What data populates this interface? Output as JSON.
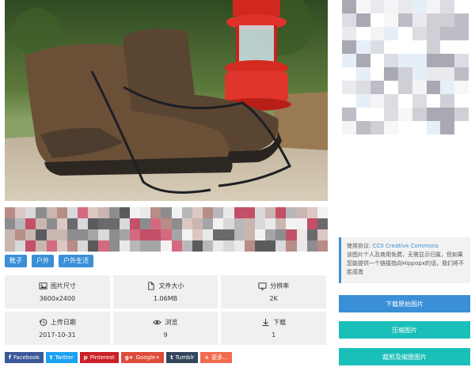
{
  "tags": [
    "靴子",
    "户外",
    "户外生活"
  ],
  "stats": [
    {
      "icon": "image-icon",
      "label": "图片尺寸",
      "value": "3600x2400"
    },
    {
      "icon": "file-icon",
      "label": "文件大小",
      "value": "1.06MB"
    },
    {
      "icon": "monitor-icon",
      "label": "分辨率",
      "value": "2K"
    },
    {
      "icon": "history-icon",
      "label": "上传日期",
      "value": "2017-10-31"
    },
    {
      "icon": "eye-icon",
      "label": "浏览",
      "value": "9"
    },
    {
      "icon": "download-icon",
      "label": "下载",
      "value": "1"
    }
  ],
  "share": [
    {
      "name": "facebook",
      "glyph": "f",
      "label": "Facebook",
      "color": "#3b5998"
    },
    {
      "name": "twitter",
      "glyph": "t",
      "label": "Twitter",
      "color": "#1da1f2"
    },
    {
      "name": "pinterest",
      "glyph": "p",
      "label": "Pinterest",
      "color": "#cb2027"
    },
    {
      "name": "googleplus",
      "glyph": "g+",
      "label": "Google+",
      "color": "#dd4b39"
    },
    {
      "name": "tumblr",
      "glyph": "t",
      "label": "Tumblr",
      "color": "#35465c"
    },
    {
      "name": "more",
      "glyph": "+",
      "label": "更多...",
      "color": "#f26b4e"
    }
  ],
  "license": {
    "prefix": "使用协议: ",
    "link": "CC0 Creative Commons",
    "text": "该图片个人及商用免费，无需显示归属，但如果您能提供一个链接指向Hippopx的话，我们将不胜感激"
  },
  "buttons": {
    "download": "下载原始图片",
    "compress": "压缩图片",
    "crop": "裁剪及缩放图片"
  },
  "colors": {
    "accent": "#3a8fd6",
    "teal": "#1bbfb9",
    "stat_bg": "#f0f0f0"
  }
}
